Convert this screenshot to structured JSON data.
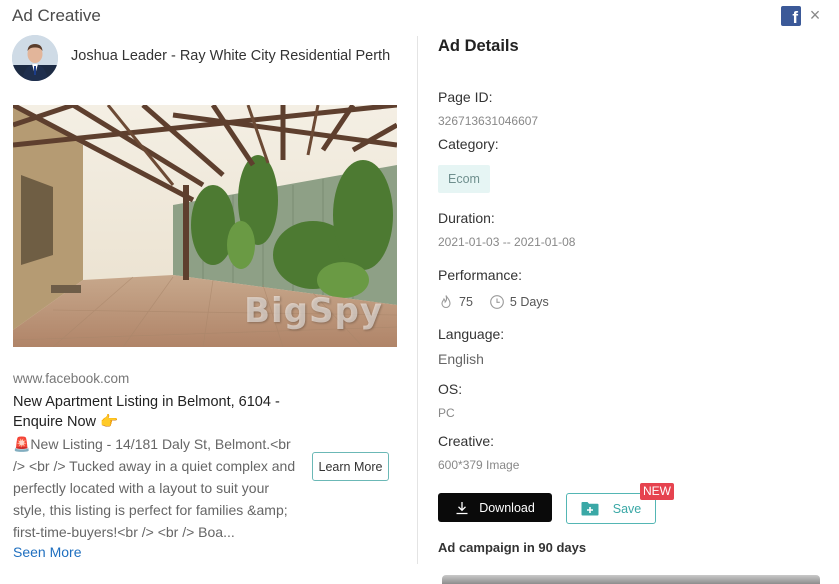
{
  "modal": {
    "title": "Ad Creative",
    "platform_icon": "facebook-icon",
    "close_icon": "close-icon",
    "close_label": "×"
  },
  "advertiser": {
    "name": "Joshua Leader - Ray White City Residential Perth",
    "avatar_icon": "avatar"
  },
  "creative": {
    "image_watermark": "BigSpy",
    "domain": "www.facebook.com",
    "title": "New Apartment Listing in Belmont, 6104 - Enquire Now 👉",
    "body": "🚨New Listing - 14/181 Daly St, Belmont.<br /> <br /> Tucked away in a quiet complex and perfectly located with a layout to suit your style, this listing is perfect for families &amp; first-time-buyers!<br /> <br /> Boa...",
    "cta": "Learn More",
    "seen_more": "Seen More"
  },
  "details": {
    "heading": "Ad Details",
    "page_id_label": "Page ID:",
    "page_id": "326713631046607",
    "category_label": "Category:",
    "category": "Ecom",
    "duration_label": "Duration:",
    "duration": "2021-01-03 -- 2021-01-08",
    "performance_label": "Performance:",
    "performance_likes": "75",
    "performance_days": "5 Days",
    "language_label": "Language:",
    "language": "English",
    "os_label": "OS:",
    "os": "PC",
    "creative_label": "Creative:",
    "creative_spec": "600*379 Image"
  },
  "actions": {
    "download": "Download",
    "save": "Save",
    "new_badge": "NEW"
  },
  "campaign": {
    "label": "Ad campaign in 90 days"
  },
  "colors": {
    "accent": "#53b6b4",
    "link": "#1f6fbf",
    "badge": "#e6434f",
    "facebook": "#3b5998"
  }
}
